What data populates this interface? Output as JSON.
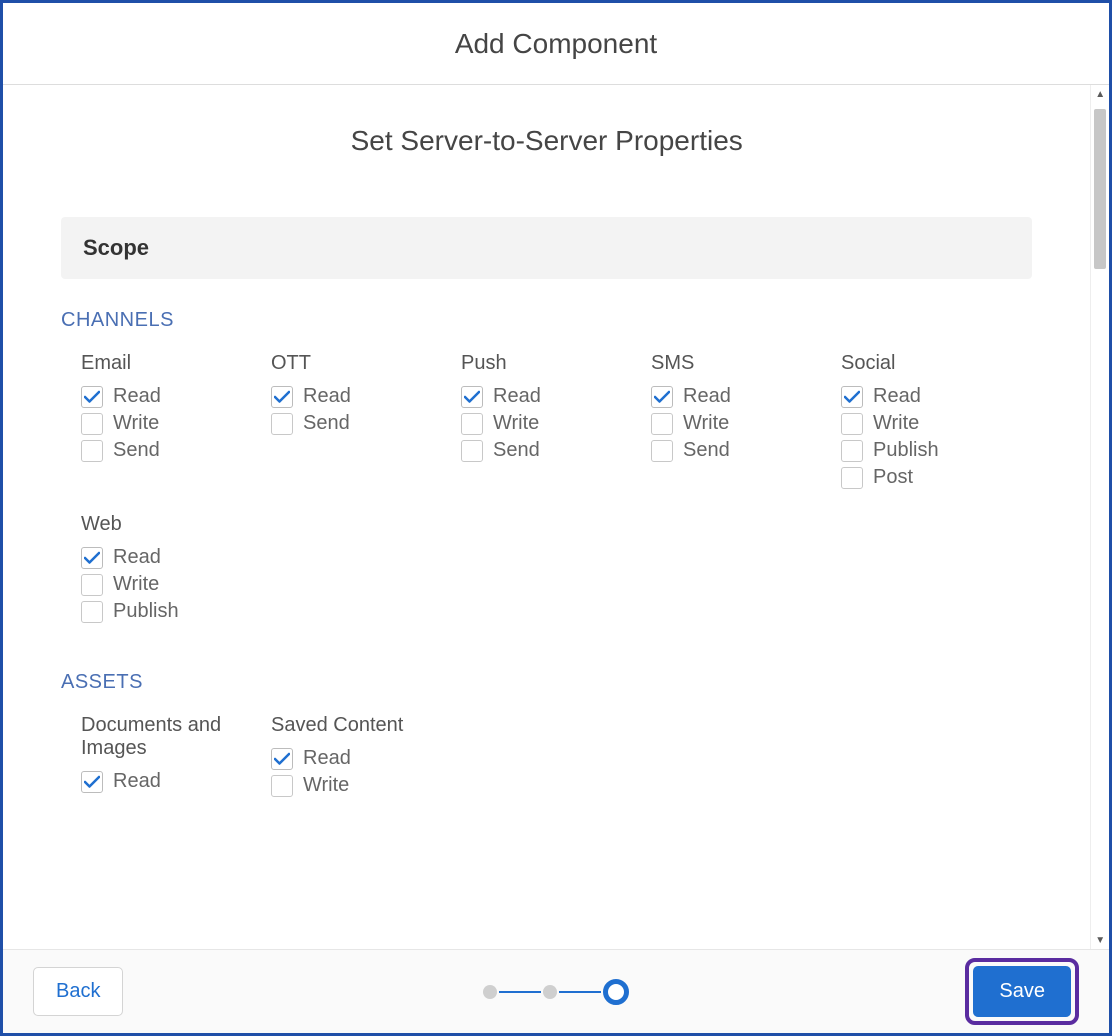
{
  "window_title": "Add Component",
  "subtitle": "Set Server-to-Server Properties",
  "section_scope": "Scope",
  "groups": {
    "channels": {
      "label": "CHANNELS",
      "cols": [
        {
          "title": "Email",
          "items": [
            {
              "label": "Read",
              "checked": true
            },
            {
              "label": "Write",
              "checked": false
            },
            {
              "label": "Send",
              "checked": false
            }
          ]
        },
        {
          "title": "OTT",
          "items": [
            {
              "label": "Read",
              "checked": true
            },
            {
              "label": "Send",
              "checked": false
            }
          ]
        },
        {
          "title": "Push",
          "items": [
            {
              "label": "Read",
              "checked": true
            },
            {
              "label": "Write",
              "checked": false
            },
            {
              "label": "Send",
              "checked": false
            }
          ]
        },
        {
          "title": "SMS",
          "items": [
            {
              "label": "Read",
              "checked": true
            },
            {
              "label": "Write",
              "checked": false
            },
            {
              "label": "Send",
              "checked": false
            }
          ]
        },
        {
          "title": "Social",
          "items": [
            {
              "label": "Read",
              "checked": true
            },
            {
              "label": "Write",
              "checked": false
            },
            {
              "label": "Publish",
              "checked": false
            },
            {
              "label": "Post",
              "checked": false
            }
          ]
        },
        {
          "title": "Web",
          "items": [
            {
              "label": "Read",
              "checked": true
            },
            {
              "label": "Write",
              "checked": false
            },
            {
              "label": "Publish",
              "checked": false
            }
          ]
        }
      ]
    },
    "assets": {
      "label": "ASSETS",
      "cols": [
        {
          "title": "Documents and Images",
          "items": [
            {
              "label": "Read",
              "checked": true
            }
          ]
        },
        {
          "title": "Saved Content",
          "items": [
            {
              "label": "Read",
              "checked": true
            },
            {
              "label": "Write",
              "checked": false
            }
          ]
        }
      ]
    }
  },
  "footer": {
    "back": "Back",
    "save": "Save"
  },
  "stepper": {
    "total": 3,
    "current": 3
  }
}
